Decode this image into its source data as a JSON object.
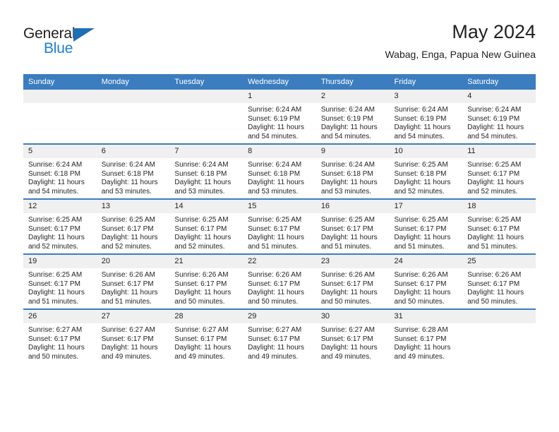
{
  "brand": {
    "name_top": "General",
    "name_bottom": "Blue",
    "accent_color": "#1b7fd4",
    "triangle_color": "#1f6fb5"
  },
  "header": {
    "title": "May 2024",
    "subtitle": "Wabag, Enga, Papua New Guinea"
  },
  "theme": {
    "header_row_bg": "#3b7dbf",
    "daynum_bg": "#f0f0f0",
    "text_color": "#231f20"
  },
  "weekday_headers": [
    "Sunday",
    "Monday",
    "Tuesday",
    "Wednesday",
    "Thursday",
    "Friday",
    "Saturday"
  ],
  "weeks": [
    [
      {
        "day": "",
        "lines": []
      },
      {
        "day": "",
        "lines": []
      },
      {
        "day": "",
        "lines": []
      },
      {
        "day": "1",
        "lines": [
          "Sunrise: 6:24 AM",
          "Sunset: 6:19 PM",
          "Daylight: 11 hours",
          "and 54 minutes."
        ]
      },
      {
        "day": "2",
        "lines": [
          "Sunrise: 6:24 AM",
          "Sunset: 6:19 PM",
          "Daylight: 11 hours",
          "and 54 minutes."
        ]
      },
      {
        "day": "3",
        "lines": [
          "Sunrise: 6:24 AM",
          "Sunset: 6:19 PM",
          "Daylight: 11 hours",
          "and 54 minutes."
        ]
      },
      {
        "day": "4",
        "lines": [
          "Sunrise: 6:24 AM",
          "Sunset: 6:19 PM",
          "Daylight: 11 hours",
          "and 54 minutes."
        ]
      }
    ],
    [
      {
        "day": "5",
        "lines": [
          "Sunrise: 6:24 AM",
          "Sunset: 6:18 PM",
          "Daylight: 11 hours",
          "and 54 minutes."
        ]
      },
      {
        "day": "6",
        "lines": [
          "Sunrise: 6:24 AM",
          "Sunset: 6:18 PM",
          "Daylight: 11 hours",
          "and 53 minutes."
        ]
      },
      {
        "day": "7",
        "lines": [
          "Sunrise: 6:24 AM",
          "Sunset: 6:18 PM",
          "Daylight: 11 hours",
          "and 53 minutes."
        ]
      },
      {
        "day": "8",
        "lines": [
          "Sunrise: 6:24 AM",
          "Sunset: 6:18 PM",
          "Daylight: 11 hours",
          "and 53 minutes."
        ]
      },
      {
        "day": "9",
        "lines": [
          "Sunrise: 6:24 AM",
          "Sunset: 6:18 PM",
          "Daylight: 11 hours",
          "and 53 minutes."
        ]
      },
      {
        "day": "10",
        "lines": [
          "Sunrise: 6:25 AM",
          "Sunset: 6:18 PM",
          "Daylight: 11 hours",
          "and 52 minutes."
        ]
      },
      {
        "day": "11",
        "lines": [
          "Sunrise: 6:25 AM",
          "Sunset: 6:17 PM",
          "Daylight: 11 hours",
          "and 52 minutes."
        ]
      }
    ],
    [
      {
        "day": "12",
        "lines": [
          "Sunrise: 6:25 AM",
          "Sunset: 6:17 PM",
          "Daylight: 11 hours",
          "and 52 minutes."
        ]
      },
      {
        "day": "13",
        "lines": [
          "Sunrise: 6:25 AM",
          "Sunset: 6:17 PM",
          "Daylight: 11 hours",
          "and 52 minutes."
        ]
      },
      {
        "day": "14",
        "lines": [
          "Sunrise: 6:25 AM",
          "Sunset: 6:17 PM",
          "Daylight: 11 hours",
          "and 52 minutes."
        ]
      },
      {
        "day": "15",
        "lines": [
          "Sunrise: 6:25 AM",
          "Sunset: 6:17 PM",
          "Daylight: 11 hours",
          "and 51 minutes."
        ]
      },
      {
        "day": "16",
        "lines": [
          "Sunrise: 6:25 AM",
          "Sunset: 6:17 PM",
          "Daylight: 11 hours",
          "and 51 minutes."
        ]
      },
      {
        "day": "17",
        "lines": [
          "Sunrise: 6:25 AM",
          "Sunset: 6:17 PM",
          "Daylight: 11 hours",
          "and 51 minutes."
        ]
      },
      {
        "day": "18",
        "lines": [
          "Sunrise: 6:25 AM",
          "Sunset: 6:17 PM",
          "Daylight: 11 hours",
          "and 51 minutes."
        ]
      }
    ],
    [
      {
        "day": "19",
        "lines": [
          "Sunrise: 6:25 AM",
          "Sunset: 6:17 PM",
          "Daylight: 11 hours",
          "and 51 minutes."
        ]
      },
      {
        "day": "20",
        "lines": [
          "Sunrise: 6:26 AM",
          "Sunset: 6:17 PM",
          "Daylight: 11 hours",
          "and 51 minutes."
        ]
      },
      {
        "day": "21",
        "lines": [
          "Sunrise: 6:26 AM",
          "Sunset: 6:17 PM",
          "Daylight: 11 hours",
          "and 50 minutes."
        ]
      },
      {
        "day": "22",
        "lines": [
          "Sunrise: 6:26 AM",
          "Sunset: 6:17 PM",
          "Daylight: 11 hours",
          "and 50 minutes."
        ]
      },
      {
        "day": "23",
        "lines": [
          "Sunrise: 6:26 AM",
          "Sunset: 6:17 PM",
          "Daylight: 11 hours",
          "and 50 minutes."
        ]
      },
      {
        "day": "24",
        "lines": [
          "Sunrise: 6:26 AM",
          "Sunset: 6:17 PM",
          "Daylight: 11 hours",
          "and 50 minutes."
        ]
      },
      {
        "day": "25",
        "lines": [
          "Sunrise: 6:26 AM",
          "Sunset: 6:17 PM",
          "Daylight: 11 hours",
          "and 50 minutes."
        ]
      }
    ],
    [
      {
        "day": "26",
        "lines": [
          "Sunrise: 6:27 AM",
          "Sunset: 6:17 PM",
          "Daylight: 11 hours",
          "and 50 minutes."
        ]
      },
      {
        "day": "27",
        "lines": [
          "Sunrise: 6:27 AM",
          "Sunset: 6:17 PM",
          "Daylight: 11 hours",
          "and 49 minutes."
        ]
      },
      {
        "day": "28",
        "lines": [
          "Sunrise: 6:27 AM",
          "Sunset: 6:17 PM",
          "Daylight: 11 hours",
          "and 49 minutes."
        ]
      },
      {
        "day": "29",
        "lines": [
          "Sunrise: 6:27 AM",
          "Sunset: 6:17 PM",
          "Daylight: 11 hours",
          "and 49 minutes."
        ]
      },
      {
        "day": "30",
        "lines": [
          "Sunrise: 6:27 AM",
          "Sunset: 6:17 PM",
          "Daylight: 11 hours",
          "and 49 minutes."
        ]
      },
      {
        "day": "31",
        "lines": [
          "Sunrise: 6:28 AM",
          "Sunset: 6:17 PM",
          "Daylight: 11 hours",
          "and 49 minutes."
        ]
      },
      {
        "day": "",
        "lines": []
      }
    ]
  ]
}
